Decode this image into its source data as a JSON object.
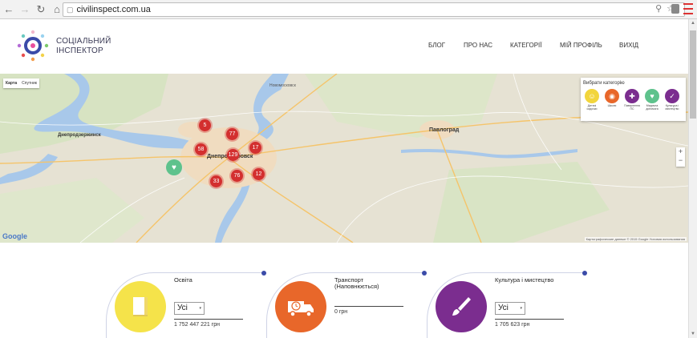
{
  "browser": {
    "url": "civilinspect.com.ua"
  },
  "header": {
    "brand_line1": "СОЦІАЛЬНИЙ",
    "brand_line2": "ІНСПЕКТОР",
    "menu": [
      "БЛОГ",
      "ПРО НАС",
      "КАТЕГОРІЇ",
      "МІЙ ПРОФІЛЬ",
      "ВИХІД"
    ]
  },
  "map": {
    "type_map": "Карта",
    "type_sat": "Спутник",
    "category_title": "Вибрати категорію",
    "categories": [
      {
        "label": "Дитячі садочки",
        "color": "#f2d53c",
        "icon": "child-icon"
      },
      {
        "label": "Школи",
        "color": "#e8672a",
        "icon": "globe-icon"
      },
      {
        "label": "Повернення ПС",
        "color": "#7b2d8f",
        "icon": "gun-icon"
      },
      {
        "label": "Медична допомога",
        "color": "#5ec28c",
        "icon": "heart-icon"
      },
      {
        "label": "Культура і мистецтво",
        "color": "#7b2d8f",
        "icon": "brush-icon"
      }
    ],
    "clusters": [
      "5",
      "77",
      "58",
      "129",
      "17",
      "76",
      "12",
      "33"
    ],
    "zoom_in": "+",
    "zoom_out": "−",
    "google": "Google",
    "attribution": "Картографические данные © 2015 Google    Условия использования",
    "cities": {
      "dnipro": "Днепропетровск",
      "pavlograd": "Павлоград",
      "dneprodzerzh": "Днепродзержинск",
      "novomoskovsk": "Новомосковск"
    }
  },
  "cards": [
    {
      "title": "Освіта",
      "subtitle": "",
      "select": "Усі",
      "amount": "1 752 447 221 грн",
      "color": "#f5e34a",
      "icon": "book-icon"
    },
    {
      "title": "Транспорт",
      "subtitle": "(Наповнюється)",
      "select": "",
      "amount": "0 грн",
      "color": "#e8672a",
      "icon": "truck-icon"
    },
    {
      "title": "Культура і мистецтво",
      "subtitle": "",
      "select": "Усі",
      "amount": "1 705 623 грн",
      "color": "#7b2d8f",
      "icon": "brush-icon"
    }
  ]
}
